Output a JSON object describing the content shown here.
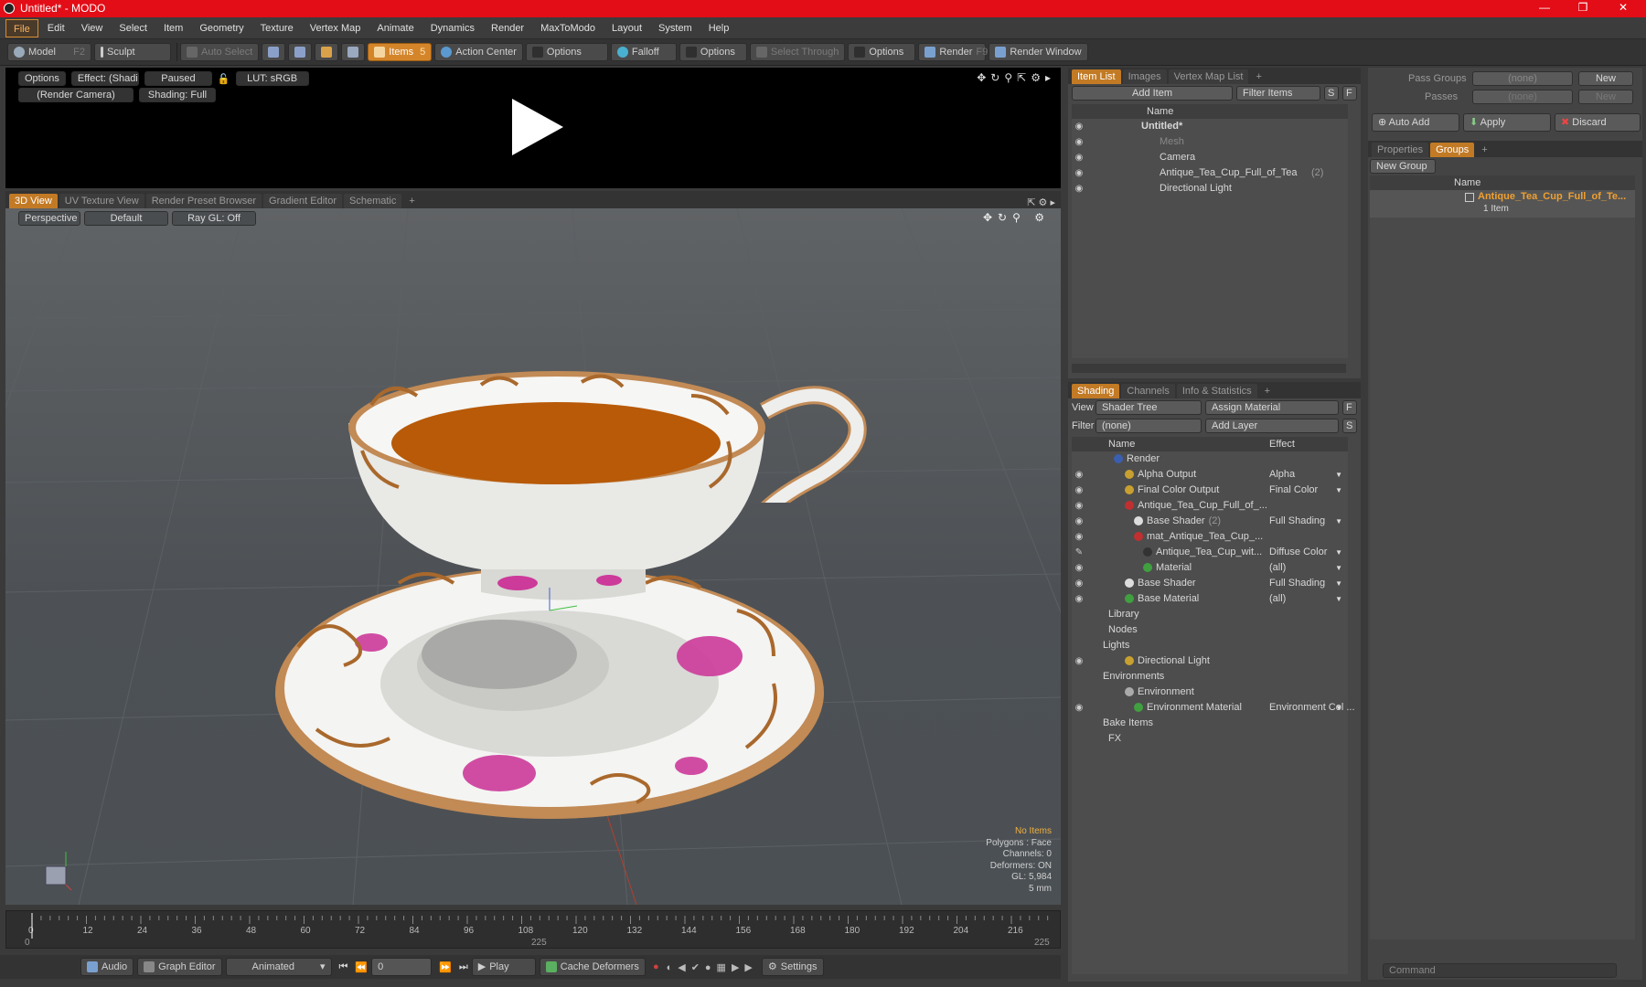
{
  "window": {
    "title": "Untitled* - MODO"
  },
  "menu": [
    "File",
    "Edit",
    "View",
    "Select",
    "Item",
    "Geometry",
    "Texture",
    "Vertex Map",
    "Animate",
    "Dynamics",
    "Render",
    "MaxToModo",
    "Layout",
    "System",
    "Help"
  ],
  "toolbar": {
    "model": "Model",
    "model_key": "F2",
    "sculpt": "Sculpt",
    "auto_select": "Auto Select",
    "items": "Items",
    "items_key": "5",
    "action_center": "Action Center",
    "options1": "Options",
    "falloff": "Falloff",
    "options2": "Options",
    "select_through": "Select Through",
    "options3": "Options",
    "render": "Render",
    "render_key": "F9",
    "render_window": "Render Window"
  },
  "preview": {
    "options": "Options",
    "effect": "Effect: (Shadi...",
    "paused": "Paused",
    "lut": "LUT: sRGB",
    "camera": "(Render Camera)",
    "shading": "Shading: Full"
  },
  "viewtabs": [
    "3D View",
    "UV Texture View",
    "Render Preset Browser",
    "Gradient Editor",
    "Schematic"
  ],
  "viewport": {
    "perspective": "Perspective",
    "default": "Default",
    "raygl": "Ray GL: Off",
    "hud_title": "No Items",
    "hud_lines": [
      "Polygons : Face",
      "Channels: 0",
      "Deformers: ON",
      "GL: 5,984",
      "5 mm"
    ]
  },
  "timeline": {
    "ticks": [
      "0",
      "12",
      "24",
      "36",
      "48",
      "60",
      "72",
      "84",
      "96",
      "108",
      "120",
      "132",
      "144",
      "156",
      "168",
      "180",
      "192",
      "204",
      "216"
    ],
    "start": "0",
    "mid": "225",
    "end": "225"
  },
  "bottombar": {
    "audio": "Audio",
    "graph_editor": "Graph Editor",
    "animated": "Animated",
    "frame": "0",
    "play": "Play",
    "cache": "Cache Deformers",
    "settings": "Settings"
  },
  "itemlist": {
    "tabs": [
      "Item List",
      "Images",
      "Vertex Map List"
    ],
    "add_item": "Add Item",
    "filter_items": "Filter Items",
    "s": "S",
    "f": "F",
    "col_name": "Name",
    "rows": [
      {
        "label": "Untitled*",
        "bold": true
      },
      {
        "label": "Mesh",
        "dim": true
      },
      {
        "label": "Camera"
      },
      {
        "label": "Antique_Tea_Cup_Full_of_Tea",
        "count": "(2)"
      },
      {
        "label": "Directional Light"
      }
    ]
  },
  "shading": {
    "tabs": [
      "Shading",
      "Channels",
      "Info & Statistics"
    ],
    "view_label": "View",
    "view_value": "Shader Tree",
    "assign": "Assign Material",
    "filter_label": "Filter",
    "filter_value": "(none)",
    "add_layer": "Add Layer",
    "f": "F",
    "s": "S",
    "col_name": "Name",
    "col_effect": "Effect",
    "rows": [
      {
        "label": "Render",
        "effect": ""
      },
      {
        "label": "Alpha Output",
        "effect": "Alpha"
      },
      {
        "label": "Final Color Output",
        "effect": "Final Color"
      },
      {
        "label": "Antique_Tea_Cup_Full_of_...",
        "effect": ""
      },
      {
        "label": "Base Shader",
        "count": "(2)",
        "effect": "Full Shading"
      },
      {
        "label": "mat_Antique_Tea_Cup_...",
        "effect": ""
      },
      {
        "label": "Antique_Tea_Cup_wit...",
        "effect": "Diffuse Color"
      },
      {
        "label": "Material",
        "effect": "(all)"
      },
      {
        "label": "Base Shader",
        "effect": "Full Shading"
      },
      {
        "label": "Base Material",
        "effect": "(all)"
      },
      {
        "label": "Library",
        "effect": ""
      },
      {
        "label": "Nodes",
        "effect": ""
      },
      {
        "label": "Lights",
        "effect": ""
      },
      {
        "label": "Directional Light",
        "effect": ""
      },
      {
        "label": "Environments",
        "effect": ""
      },
      {
        "label": "Environment",
        "effect": ""
      },
      {
        "label": "Environment Material",
        "effect": "Environment Col ..."
      },
      {
        "label": "Bake Items",
        "effect": ""
      },
      {
        "label": "FX",
        "effect": ""
      }
    ]
  },
  "groups": {
    "pass_groups": "Pass Groups",
    "passes": "Passes",
    "none": "(none)",
    "new": "New",
    "auto_add": "Auto Add",
    "apply": "Apply",
    "discard": "Discard",
    "tabs": [
      "Properties",
      "Groups"
    ],
    "new_group": "New Group",
    "col_name": "Name",
    "group_name": "Antique_Tea_Cup_Full_of_Te...",
    "group_sub": "1 Item"
  },
  "command": {
    "placeholder": "Command"
  },
  "colors": {
    "accent": "#c27a25",
    "title": "#e20d17"
  }
}
